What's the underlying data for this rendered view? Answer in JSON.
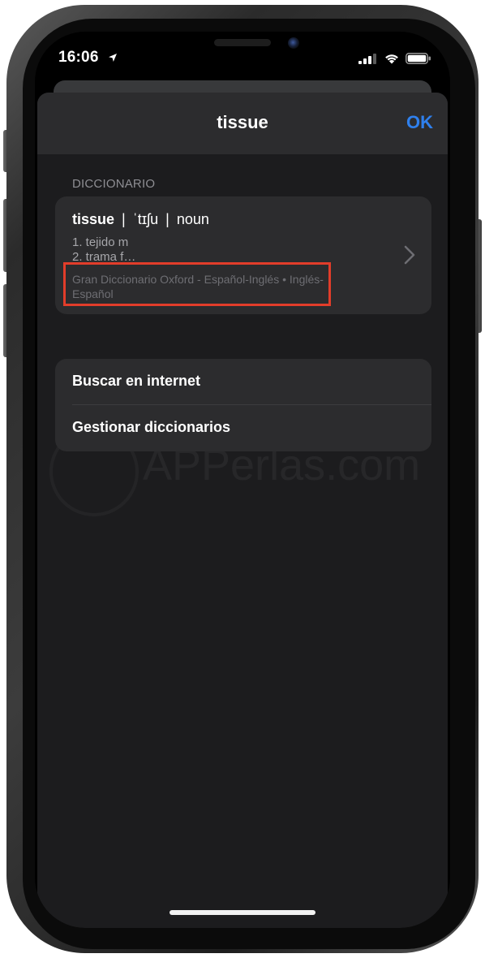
{
  "status_bar": {
    "time": "16:06",
    "icons": [
      "location-arrow-icon",
      "signal-icon",
      "wifi-icon",
      "battery-icon"
    ]
  },
  "sheet": {
    "title": "tissue",
    "done_label": "OK"
  },
  "dictionary_section": {
    "header": "DICCIONARIO",
    "entry": {
      "word": "tissue",
      "separator": "|",
      "pronunciation": "ˈtɪʃu",
      "part_of_speech": "noun",
      "definitions": [
        "1. tejido m",
        "2. trama f…"
      ],
      "source": "Gran Diccionario Oxford - Español-Inglés • Inglés-Español"
    }
  },
  "actions": [
    {
      "label": "Buscar en internet"
    },
    {
      "label": "Gestionar diccionarios"
    }
  ],
  "watermark": "APPerlas.com",
  "colors": {
    "sheet_background": "#1c1c1e",
    "card_background": "#2c2c2e",
    "accent": "#2f80ed",
    "highlight": "#e23d2a"
  }
}
